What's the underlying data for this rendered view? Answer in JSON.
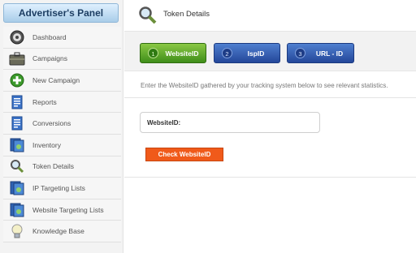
{
  "sidebar": {
    "header": "Advertiser's Panel",
    "items": [
      {
        "label": "Dashboard",
        "icon": "dashboard-icon"
      },
      {
        "label": "Campaigns",
        "icon": "briefcase-icon"
      },
      {
        "label": "New Campaign",
        "icon": "add-icon"
      },
      {
        "label": "Reports",
        "icon": "report-document-icon"
      },
      {
        "label": "Conversions",
        "icon": "conversions-document-icon"
      },
      {
        "label": "Inventory",
        "icon": "inventory-icon"
      },
      {
        "label": "Token Details",
        "icon": "magnifier-icon"
      },
      {
        "label": "IP Targeting Lists",
        "icon": "ip-list-icon"
      },
      {
        "label": "Website Targeting Lists",
        "icon": "website-list-icon"
      },
      {
        "label": "Knowledge Base",
        "icon": "lightbulb-icon"
      }
    ]
  },
  "main": {
    "title": "Token Details",
    "title_icon": "magnifier-icon",
    "tabs": [
      {
        "number": "1",
        "label": "WebsiteID",
        "color": "#4f9a25"
      },
      {
        "number": "2",
        "label": "IspID",
        "color": "#2c52a8"
      },
      {
        "number": "3",
        "label": "URL - ID",
        "color": "#2c52a8"
      }
    ],
    "instructions": "Enter the WebsiteID gathered by your tracking system below to see relevant statistics.",
    "field": {
      "label": "WebsiteID:",
      "value": "",
      "placeholder": ""
    },
    "button_label": "Check WebsiteID",
    "button_color": "#f05a1a"
  }
}
